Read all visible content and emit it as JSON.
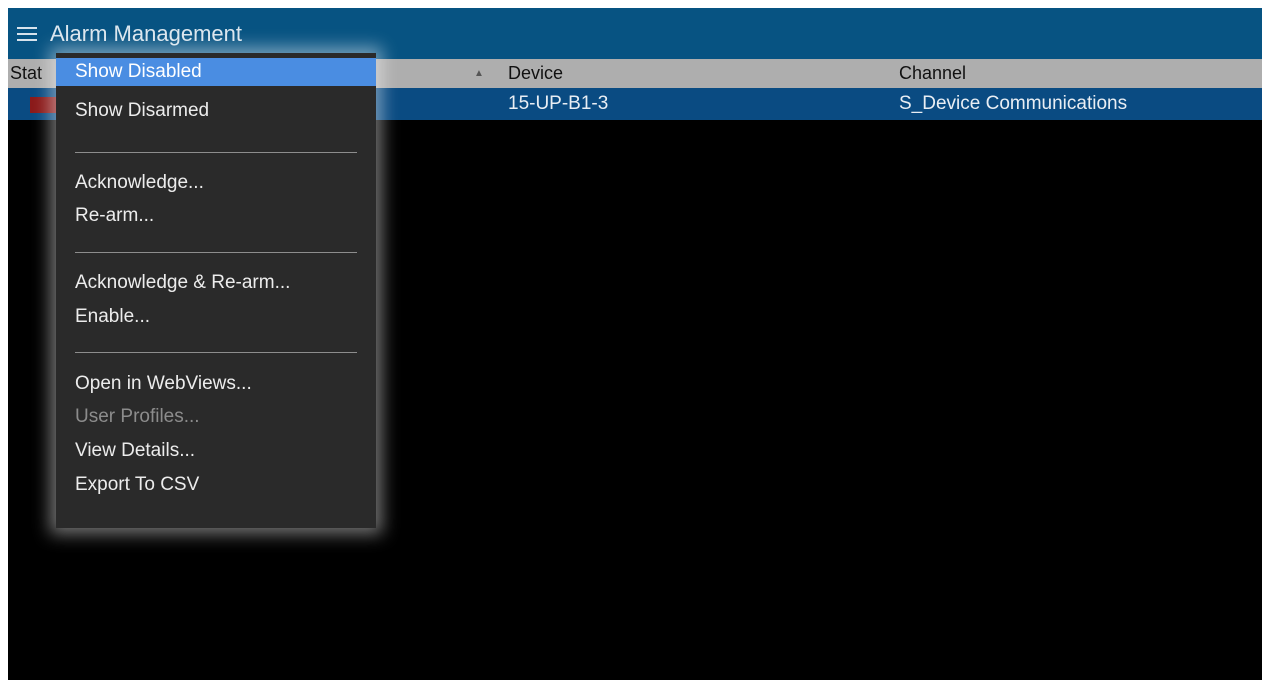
{
  "window": {
    "title": "Alarm Management",
    "menu_icon": "hamburger-menu-icon",
    "title_bar_color": "#075382"
  },
  "table": {
    "headers": {
      "status": "Stat",
      "sort_indicator": "▲",
      "device": "Device",
      "channel": "Channel"
    },
    "rows": [
      {
        "status_color": "#8b1a1a",
        "device": "15-UP-B1-3",
        "channel": "S_Device Communications",
        "selected": true
      }
    ],
    "selected_row_color": "#0a4b82"
  },
  "context_menu": {
    "highlight_color": "#4a8de2",
    "items": [
      {
        "label": "Show Disabled",
        "highlighted": true
      },
      {
        "label": "Show Disarmed"
      },
      {
        "label": "Acknowledge..."
      },
      {
        "label": "Re-arm..."
      },
      {
        "label": "Acknowledge & Re-arm..."
      },
      {
        "label": "Enable..."
      },
      {
        "label": "Open in WebViews..."
      },
      {
        "label": "User Profiles...",
        "disabled": true
      },
      {
        "label": "View Details..."
      },
      {
        "label": "Export To CSV"
      }
    ]
  }
}
